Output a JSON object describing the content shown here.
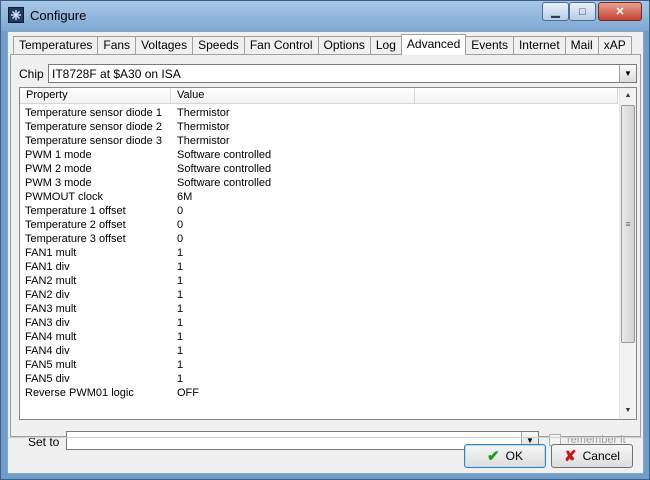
{
  "window": {
    "title": "Configure"
  },
  "titlebar_buttons": {
    "minimize": "▁",
    "maximize": "□",
    "close": "✕"
  },
  "tabs": [
    {
      "label": "Temperatures"
    },
    {
      "label": "Fans"
    },
    {
      "label": "Voltages"
    },
    {
      "label": "Speeds"
    },
    {
      "label": "Fan Control"
    },
    {
      "label": "Options"
    },
    {
      "label": "Log"
    },
    {
      "label": "Advanced",
      "active": true
    },
    {
      "label": "Events"
    },
    {
      "label": "Internet"
    },
    {
      "label": "Mail"
    },
    {
      "label": "xAP"
    }
  ],
  "chip": {
    "label": "Chip",
    "value": "IT8728F at $A30 on ISA"
  },
  "grid": {
    "headers": {
      "property": "Property",
      "value": "Value"
    },
    "rows": [
      {
        "property": "Temperature sensor diode 1",
        "value": "Thermistor"
      },
      {
        "property": "Temperature sensor diode 2",
        "value": "Thermistor"
      },
      {
        "property": "Temperature sensor diode 3",
        "value": "Thermistor"
      },
      {
        "property": "PWM 1 mode",
        "value": "Software controlled"
      },
      {
        "property": "PWM 2 mode",
        "value": "Software controlled"
      },
      {
        "property": "PWM 3 mode",
        "value": "Software controlled"
      },
      {
        "property": "PWMOUT clock",
        "value": "6M"
      },
      {
        "property": "Temperature 1 offset",
        "value": "0"
      },
      {
        "property": "Temperature 2 offset",
        "value": "0"
      },
      {
        "property": "Temperature 3 offset",
        "value": "0"
      },
      {
        "property": "FAN1 mult",
        "value": "1"
      },
      {
        "property": "FAN1 div",
        "value": "1"
      },
      {
        "property": "FAN2 mult",
        "value": "1"
      },
      {
        "property": "FAN2 div",
        "value": "1"
      },
      {
        "property": "FAN3 mult",
        "value": "1"
      },
      {
        "property": "FAN3 div",
        "value": "1"
      },
      {
        "property": "FAN4 mult",
        "value": "1"
      },
      {
        "property": "FAN4 div",
        "value": "1"
      },
      {
        "property": "FAN5 mult",
        "value": "1"
      },
      {
        "property": "FAN5 div",
        "value": "1"
      },
      {
        "property": "Reverse PWM01 logic",
        "value": "OFF"
      }
    ]
  },
  "set_to": {
    "label": "Set to",
    "value": ""
  },
  "remember": {
    "label": "remember it",
    "checked": false
  },
  "buttons": {
    "ok": "OK",
    "cancel": "Cancel"
  }
}
